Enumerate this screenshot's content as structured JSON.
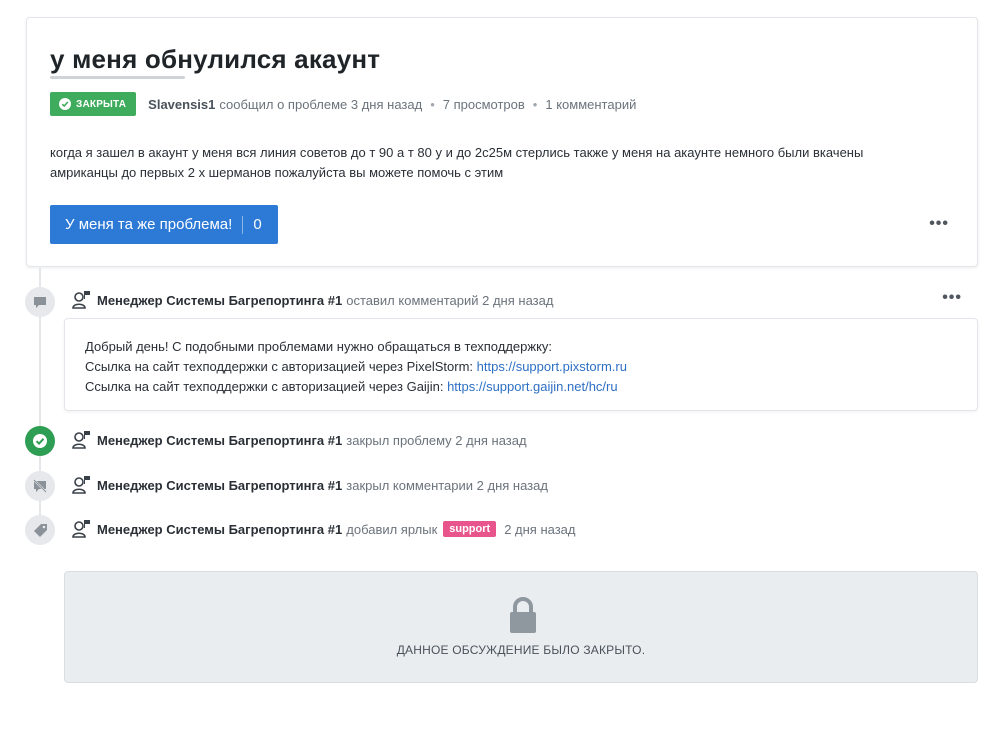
{
  "issue": {
    "title": "у меня обнулился акаунт",
    "status": "ЗАКРЫТА",
    "author": "Slavensis1",
    "reported": "сообщил о проблеме 3 дня назад",
    "views": "7 просмотров",
    "comments": "1 комментарий",
    "body_line1": "когда я зашел в акаунт у меня вся линия советов до т 90 а т 80 у и до 2с25м стерлись также у меня на акаунте немного были вкачены",
    "body_line2": "амриканцы до первых 2 х шерманов пожалуйста вы можете помочь с этим",
    "me_too_label": "У меня та же проблема!",
    "me_too_count": "0",
    "more": "•••"
  },
  "timeline": {
    "actor": "Менеджер Системы Багрепортинга #1",
    "comment_event": {
      "action": "оставил комментарий 2 дня назад",
      "more": "•••",
      "line1": "Добрый день! С подобными проблемами нужно обращаться в техподдержку:",
      "line2_prefix": "Ссылка на сайт техподдержки с авторизацией через PixelStorm:",
      "line2_link": "https://support.pixstorm.ru",
      "line3_prefix": "Ссылка на сайт техподдержки с авторизацией через Gaijin:",
      "line3_link": "https://support.gaijin.net/hc/ru"
    },
    "closed_event": {
      "action": "закрыл проблему 2 дня назад"
    },
    "locked_event": {
      "action": "закрыл комментарии 2 дня назад"
    },
    "label_event": {
      "action": "добавил ярлык",
      "label": "support",
      "time": "2 дня назад"
    }
  },
  "closed_notice": "ДАННОЕ ОБСУЖДЕНИЕ БЫЛО ЗАКРЫТО.",
  "colors": {
    "status_green": "#3fab5c",
    "button_blue": "#2d7ad6",
    "link_blue": "#2d6fc4",
    "label_pink": "#e8558c"
  },
  "icons": [
    "check-circle-icon",
    "comment-icon",
    "check-icon",
    "comment-slash-icon",
    "tag-icon",
    "manager-avatar-icon",
    "lock-icon"
  ]
}
